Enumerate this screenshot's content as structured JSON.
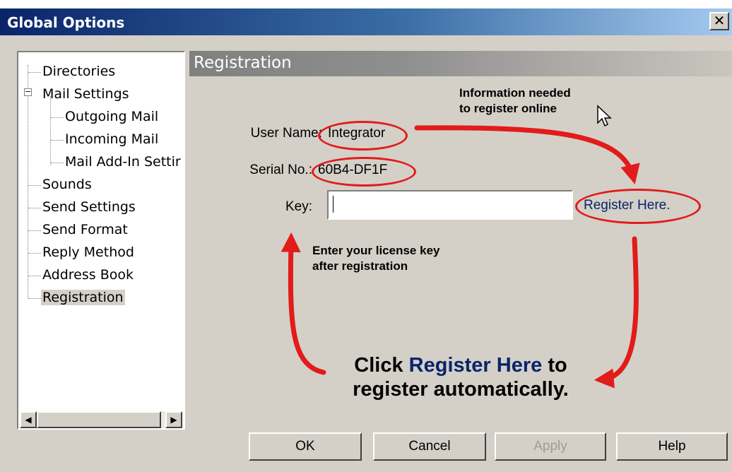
{
  "window": {
    "title": "Global Options",
    "close_glyph": "✕"
  },
  "tree": {
    "items": [
      {
        "label": "Directories"
      },
      {
        "label": "Mail Settings",
        "expander": "−"
      },
      {
        "label": "Outgoing Mail"
      },
      {
        "label": "Incoming Mail"
      },
      {
        "label": "Mail Add-In Settir"
      },
      {
        "label": "Sounds"
      },
      {
        "label": "Send Settings"
      },
      {
        "label": "Send Format"
      },
      {
        "label": "Reply Method"
      },
      {
        "label": "Address Book"
      },
      {
        "label": "Registration",
        "selected": true
      }
    ],
    "scroll_left": "◀",
    "scroll_right": "▶"
  },
  "section": {
    "title": "Registration"
  },
  "form": {
    "user_name_label": "User Name:",
    "user_name_value": "Integrator",
    "serial_label": "Serial No.:",
    "serial_value": "60B4-DF1F",
    "key_label": "Key:",
    "key_value": "",
    "register_link": "Register Here."
  },
  "annotations": {
    "info_line1": "Information needed",
    "info_line2": "to register online",
    "enter_line1": "Enter your license key",
    "enter_line2": "after registration",
    "big_part1": "Click ",
    "big_highlight": "Register Here",
    "big_part2": " to register automatically."
  },
  "buttons": {
    "ok": "OK",
    "cancel": "Cancel",
    "apply": "Apply",
    "help": "Help"
  },
  "colors": {
    "annotation_red": "#e21b1b",
    "link_blue": "#0a246a",
    "titlebar_dark": "#0a246a",
    "dialog_face": "#d4d0c8"
  }
}
